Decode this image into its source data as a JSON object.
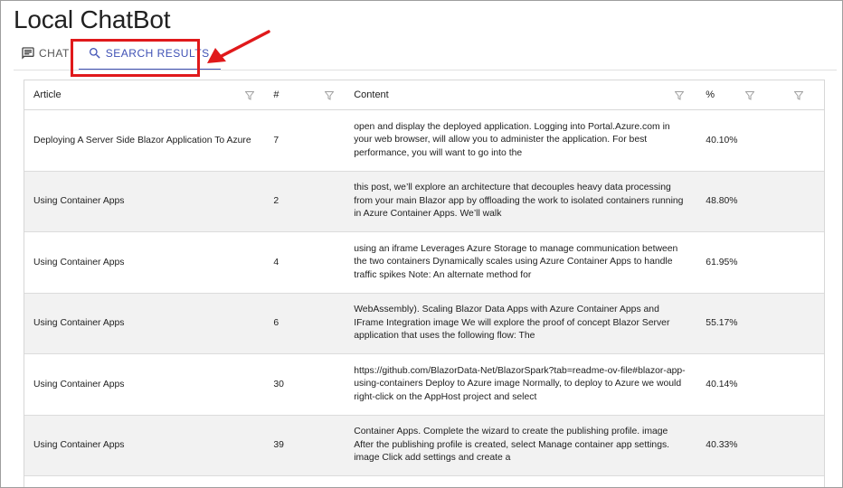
{
  "app": {
    "title": "Local ChatBot"
  },
  "tabs": [
    {
      "label": "CHAT",
      "icon": "chat-icon",
      "active": false
    },
    {
      "label": "SEARCH RESULTS",
      "icon": "search-icon",
      "active": true
    }
  ],
  "colors": {
    "accent": "#3f51b5",
    "highlight": "#e0191b",
    "row_alt": "#f2f2f2"
  },
  "grid": {
    "columns": [
      {
        "label": "Article",
        "filter": true
      },
      {
        "label": "#",
        "filter": true
      },
      {
        "label": "Content",
        "filter": true
      },
      {
        "label": "%",
        "filter": true
      },
      {
        "label": "",
        "filter": true
      }
    ],
    "rows": [
      {
        "article": "Deploying A Server Side Blazor Application To Azure",
        "num": "7",
        "content": "open and display the deployed application. Logging into Portal.Azure.com in your web browser, will allow you to administer the application. For best performance, you will want to go into the",
        "pct": "40.10%"
      },
      {
        "article": "Using Container Apps",
        "num": "2",
        "content": "this post, we’ll explore an architecture that decouples heavy data processing from your main Blazor app by offloading the work to isolated containers running in Azure Container Apps. We’ll walk",
        "pct": "48.80%"
      },
      {
        "article": "Using Container Apps",
        "num": "4",
        "content": "using an iframe Leverages Azure Storage to manage communication between the two containers Dynamically scales using Azure Container Apps to handle traffic spikes Note: An alternate method for",
        "pct": "61.95%"
      },
      {
        "article": "Using Container Apps",
        "num": "6",
        "content": "WebAssembly). Scaling Blazor Data Apps with Azure Container Apps and IFrame Integration image We will explore the proof of concept Blazor Server application that uses the following flow: The",
        "pct": "55.17%"
      },
      {
        "article": "Using Container Apps",
        "num": "30",
        "content": "https://github.com/BlazorData-Net/BlazorSpark?tab=readme-ov-file#blazor-app-using-containers Deploy to Azure image Normally, to deploy to Azure we would right-click on the AppHost project and select",
        "pct": "40.14%"
      },
      {
        "article": "Using Container Apps",
        "num": "39",
        "content": "Container Apps. Complete the wizard to create the publishing profile. image After the publishing profile is created, select Manage container app settings. image Click add settings and create a",
        "pct": "40.33%"
      }
    ]
  }
}
